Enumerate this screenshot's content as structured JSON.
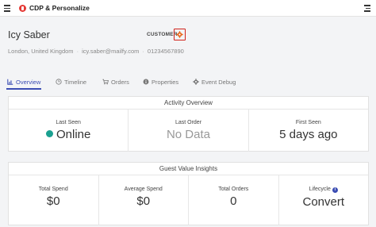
{
  "app": {
    "title": "CDP & Personalize"
  },
  "profile": {
    "name": "Icy Saber",
    "badge": "CUSTOMER",
    "location": "London, United Kingdom",
    "email": "icy.saber@mailfy.com",
    "phone": "01234567890"
  },
  "tabs": [
    {
      "label": "Overview",
      "icon": "chart-icon",
      "active": true
    },
    {
      "label": "Timeline",
      "icon": "clock-icon",
      "active": false
    },
    {
      "label": "Orders",
      "icon": "cart-icon",
      "active": false
    },
    {
      "label": "Properties",
      "icon": "info-icon",
      "active": false
    },
    {
      "label": "Event Debug",
      "icon": "gear-icon",
      "active": false
    }
  ],
  "activity": {
    "title": "Activity Overview",
    "last_seen_label": "Last Seen",
    "last_seen_value": "Online",
    "last_order_label": "Last Order",
    "last_order_value": "No Data",
    "first_seen_label": "First Seen",
    "first_seen_value": "5 days ago"
  },
  "insights": {
    "title": "Guest Value Insights",
    "total_spend_label": "Total Spend",
    "total_spend_value": "$0",
    "average_spend_label": "Average Spend",
    "average_spend_value": "$0",
    "total_orders_label": "Total Orders",
    "total_orders_value": "0",
    "lifecycle_label": "Lifecycle",
    "lifecycle_value": "Convert"
  },
  "colors": {
    "accent": "#3b4db3",
    "online": "#1aa090",
    "highlight_border": "#d0221b",
    "gear": "#e8671b"
  }
}
